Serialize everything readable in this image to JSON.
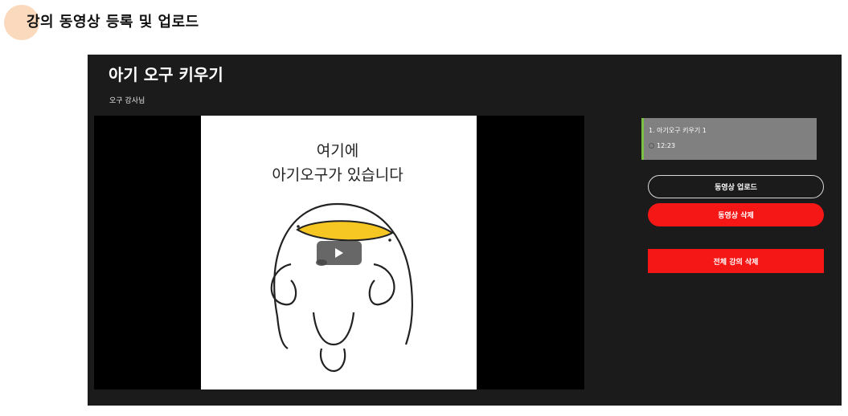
{
  "page": {
    "heading": "강의 동영상 등록 및 업로드"
  },
  "course": {
    "title": "아기 오구 키우기",
    "instructor": "오구 강사님"
  },
  "video": {
    "caption_line1": "여기에",
    "caption_line2": "아기오구가 있습니다"
  },
  "lessons": [
    {
      "title": "1. 아기오구 키우기 1",
      "duration": "12:23"
    }
  ],
  "actions": {
    "upload_label": "동영상 업로드",
    "delete_label": "동영상 삭제",
    "delete_all_label": "전체 강의 삭제"
  },
  "colors": {
    "panel_bg": "#1b1b1b",
    "accent_red": "#f51616",
    "lesson_bg": "#808080",
    "lesson_active_bar": "#7ac143",
    "heading_dot": "#fbd9bd"
  }
}
